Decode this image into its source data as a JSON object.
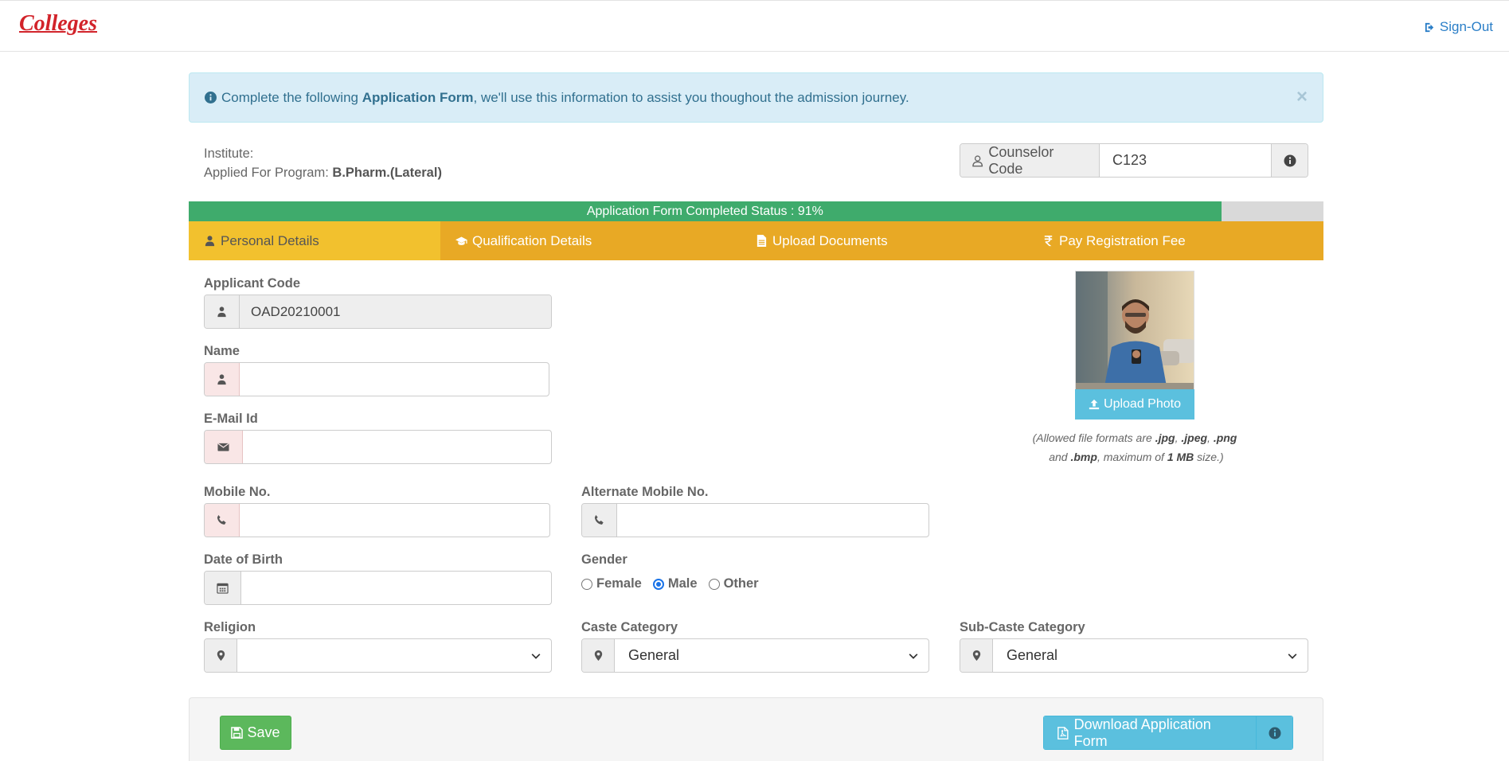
{
  "header": {
    "logo": "Colleges",
    "signout_label": "Sign-Out"
  },
  "alert": {
    "text_before": "Complete the following ",
    "text_bold": "Application Form",
    "text_after": ", we'll use this information to assist you thoughout the admission journey.",
    "close_symbol": "×"
  },
  "institute": {
    "institute_label": "Institute:",
    "program_label": "Applied For Program: ",
    "program_value": "B.Pharm.(Lateral)"
  },
  "counselor": {
    "label": "Counselor Code",
    "value": "C123"
  },
  "progress": {
    "label": "Application Form Completed Status : 91%",
    "percent": 91
  },
  "tabs": [
    {
      "label": "Personal Details",
      "icon": "user-icon",
      "active": true
    },
    {
      "label": "Qualification Details",
      "icon": "graduation-cap-icon"
    },
    {
      "label": "Upload Documents",
      "icon": "file-icon"
    },
    {
      "label": "Pay Registration Fee",
      "icon": "rupee-icon"
    }
  ],
  "form": {
    "applicant_code": {
      "label": "Applicant Code",
      "value": "OAD20210001"
    },
    "name": {
      "label": "Name",
      "value": ""
    },
    "email": {
      "label": "E-Mail Id",
      "value": ""
    },
    "mobile": {
      "label": "Mobile No.",
      "value": ""
    },
    "alt_mobile": {
      "label": "Alternate Mobile No.",
      "value": ""
    },
    "dob": {
      "label": "Date of Birth",
      "value": ""
    },
    "gender": {
      "label": "Gender",
      "options": [
        "Female",
        "Male",
        "Other"
      ],
      "selected": "Male"
    },
    "religion": {
      "label": "Religion",
      "value": ""
    },
    "caste": {
      "label": "Caste Category",
      "value": "General"
    },
    "subcaste": {
      "label": "Sub-Caste Category",
      "value": "General"
    }
  },
  "photo": {
    "upload_label": "Upload Photo",
    "allowed_prefix": "(Allowed file formats are ",
    "fmt1": ".jpg",
    "sep1": ", ",
    "fmt2": ".jpeg",
    "sep2": ", ",
    "fmt3": ".png",
    "and": " and ",
    "fmt4": ".bmp",
    "max_text": ", maximum of ",
    "max_size": "1 MB",
    "suffix": " size.)"
  },
  "footer": {
    "save_label": "Save",
    "download_label": "Download Application Form"
  },
  "colors": {
    "brand_red": "#d2232a",
    "progress_green": "#3fab6c",
    "tab_orange": "#e8a925",
    "tab_active": "#f2c12e",
    "info_blue": "#5bc0de",
    "save_green": "#5cb85c"
  }
}
